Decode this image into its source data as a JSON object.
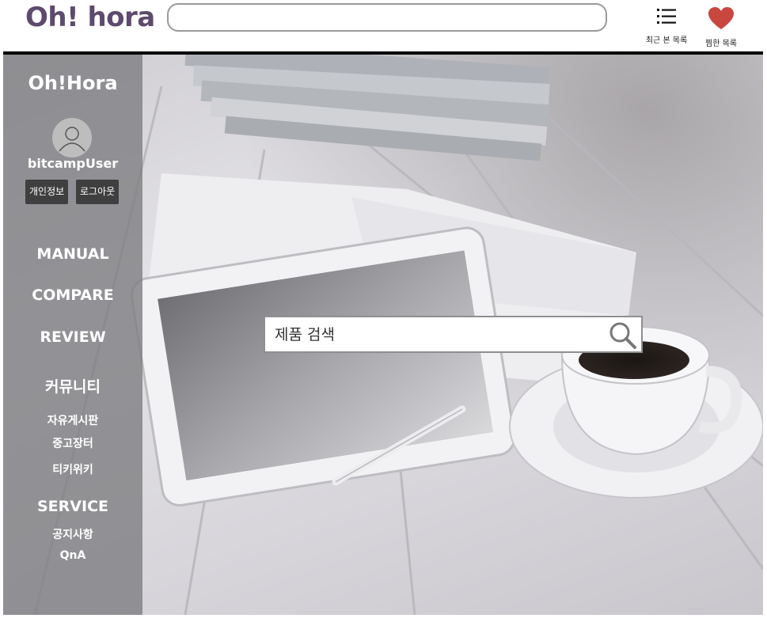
{
  "header": {
    "logo": "Oh! hora",
    "search": {
      "value": "",
      "placeholder": ""
    },
    "recent": {
      "label": "최근 본 목록",
      "icon": "list-icon"
    },
    "wishlist": {
      "label": "찜한 목록",
      "icon": "heart-icon",
      "color": "#c8473f"
    }
  },
  "sidebar": {
    "brand": "Oh!Hora",
    "avatar_icon": "user-avatar-icon",
    "username": "bitcampUser",
    "profile_button": "개인정보",
    "logout_button": "로그아웃",
    "menu": {
      "manual": "MANUAL",
      "compare": "COMPARE",
      "review": "REVIEW",
      "community": {
        "title": "커뮤니티",
        "items": [
          "자유게시판",
          "중고장터",
          "티키위키"
        ]
      },
      "service": {
        "title": "SERVICE",
        "items": [
          "공지사항",
          "QnA"
        ]
      }
    }
  },
  "main": {
    "search": {
      "placeholder": "제품 검색",
      "icon": "search-icon"
    }
  },
  "colors": {
    "logo": "#5e4a6e",
    "sidebar_overlay": "#808084",
    "mini_button": "#3f3f3f"
  }
}
